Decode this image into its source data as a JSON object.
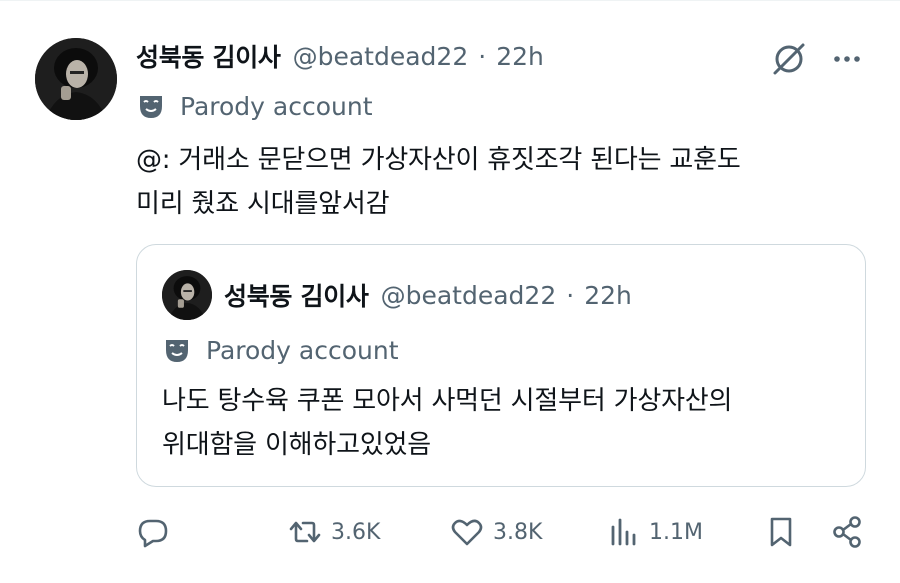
{
  "tweet": {
    "display_name": "성북동 김이사",
    "handle": "@beatdead22",
    "separator": "·",
    "time": "22h",
    "label": "Parody account",
    "text_line1": "@: 거래소 문닫으면 가상자산이 휴짓조각 된다는 교훈도",
    "text_line2": "미리 줬죠 시대를앞서감"
  },
  "quoted": {
    "display_name": "성북동 김이사",
    "handle": "@beatdead22",
    "separator": "·",
    "time": "22h",
    "label": "Parody account",
    "text_line1": "나도 탕수육 쿠폰 모아서 사먹던 시절부터 가상자산의",
    "text_line2": "위대함을 이해하고있었음"
  },
  "actions": {
    "reposts": "3.6K",
    "likes": "3.8K",
    "views": "1.1M"
  },
  "icons": {
    "grok": "grok-icon",
    "more": "more-horizontal-icon",
    "parody": "theater-mask-icon",
    "reply": "reply-bubble-icon",
    "repost": "repost-icon",
    "like": "heart-icon",
    "views": "bar-chart-icon",
    "bookmark": "bookmark-icon",
    "share": "share-nodes-icon"
  },
  "colors": {
    "text_primary": "#0f1419",
    "text_secondary": "#536471",
    "border": "#cfd9de"
  }
}
